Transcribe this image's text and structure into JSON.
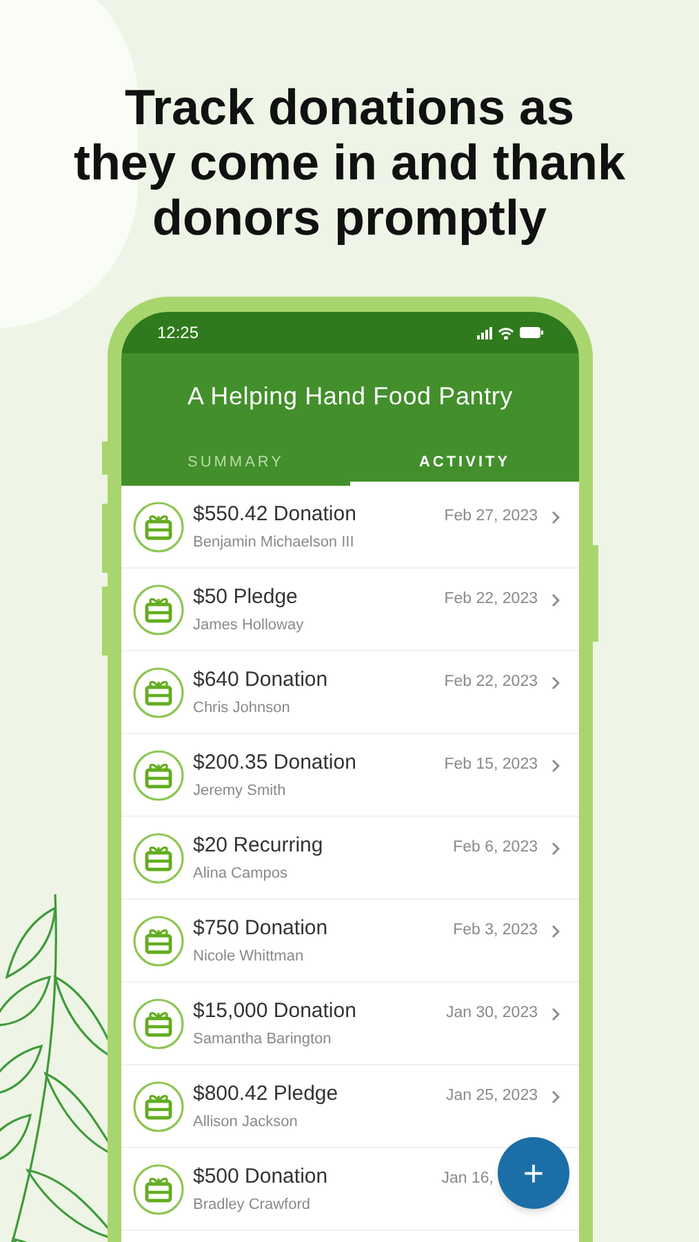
{
  "headline": [
    "Track donations as",
    "they come in and thank",
    "donors promptly"
  ],
  "status_bar": {
    "time": "12:25"
  },
  "app_title": "A Helping Hand Food Pantry",
  "tabs": [
    {
      "label": "SUMMARY",
      "selected": false
    },
    {
      "label": "ACTIVITY",
      "selected": true
    }
  ],
  "activity": [
    {
      "title": "$550.42 Donation",
      "donor": "Benjamin Michaelson III",
      "date": "Feb 27, 2023",
      "chevron": true
    },
    {
      "title": "$50 Pledge",
      "donor": "James Holloway",
      "date": "Feb 22, 2023",
      "chevron": true
    },
    {
      "title": "$640 Donation",
      "donor": "Chris Johnson",
      "date": "Feb 22, 2023",
      "chevron": true
    },
    {
      "title": "$200.35 Donation",
      "donor": "Jeremy Smith",
      "date": "Feb 15, 2023",
      "chevron": true
    },
    {
      "title": "$20 Recurring",
      "donor": "Alina Campos",
      "date": "Feb 6, 2023",
      "chevron": true
    },
    {
      "title": "$750 Donation",
      "donor": "Nicole Whittman",
      "date": "Feb 3, 2023",
      "chevron": true
    },
    {
      "title": "$15,000 Donation",
      "donor": "Samantha Barington",
      "date": "Jan 30, 2023",
      "chevron": true
    },
    {
      "title": "$800.42 Pledge",
      "donor": "Allison Jackson",
      "date": "Jan 25, 2023",
      "chevron": true
    },
    {
      "title": "$500 Donation",
      "donor": "Bradley Crawford",
      "date": "Jan 16,",
      "chevron": false
    }
  ],
  "fab": {
    "label": "+"
  }
}
